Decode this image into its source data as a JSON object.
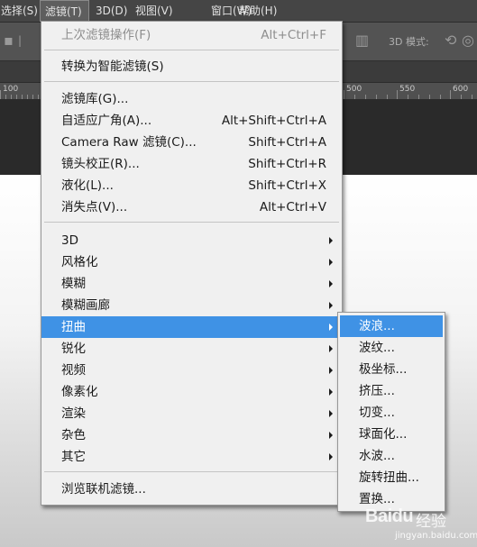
{
  "menubar": {
    "items": [
      "选择(S)",
      "滤镜(T)",
      "3D(D)",
      "视图(V)",
      "窗口(W)",
      "帮助(H)"
    ],
    "active_index": 1
  },
  "options_bar": {
    "mode_label": "3D 模式:"
  },
  "ruler": {
    "labels": [
      "100",
      "500",
      "550",
      "600"
    ]
  },
  "filter_menu": {
    "items": [
      {
        "label": "上次滤镜操作(F)",
        "shortcut": "Alt+Ctrl+F",
        "disabled": true
      },
      {
        "label": "转换为智能滤镜(S)",
        "shortcut": ""
      },
      {
        "label": "滤镜库(G)...",
        "shortcut": ""
      },
      {
        "label": "自适应广角(A)...",
        "shortcut": "Alt+Shift+Ctrl+A"
      },
      {
        "label": "Camera Raw 滤镜(C)...",
        "shortcut": "Shift+Ctrl+A"
      },
      {
        "label": "镜头校正(R)...",
        "shortcut": "Shift+Ctrl+R"
      },
      {
        "label": "液化(L)...",
        "shortcut": "Shift+Ctrl+X"
      },
      {
        "label": "消失点(V)...",
        "shortcut": "Alt+Ctrl+V"
      },
      {
        "label": "3D",
        "submenu": true
      },
      {
        "label": "风格化",
        "submenu": true
      },
      {
        "label": "模糊",
        "submenu": true
      },
      {
        "label": "模糊画廊",
        "submenu": true
      },
      {
        "label": "扭曲",
        "submenu": true,
        "highlighted": true
      },
      {
        "label": "锐化",
        "submenu": true
      },
      {
        "label": "视频",
        "submenu": true
      },
      {
        "label": "像素化",
        "submenu": true
      },
      {
        "label": "渲染",
        "submenu": true
      },
      {
        "label": "杂色",
        "submenu": true
      },
      {
        "label": "其它",
        "submenu": true
      },
      {
        "label": "浏览联机滤镜..."
      }
    ]
  },
  "distort_submenu": {
    "items": [
      "波浪...",
      "波纹...",
      "极坐标...",
      "挤压...",
      "切变...",
      "球面化...",
      "水波...",
      "旋转扭曲...",
      "置换..."
    ],
    "highlighted_index": 0
  },
  "watermark": {
    "brand": "Baidu",
    "suffix": "经验",
    "url": "jingyan.baidu.com"
  },
  "colors": {
    "highlight": "#3f92e5",
    "menu_bg": "#f0f0f0",
    "app_bg": "#535353"
  }
}
